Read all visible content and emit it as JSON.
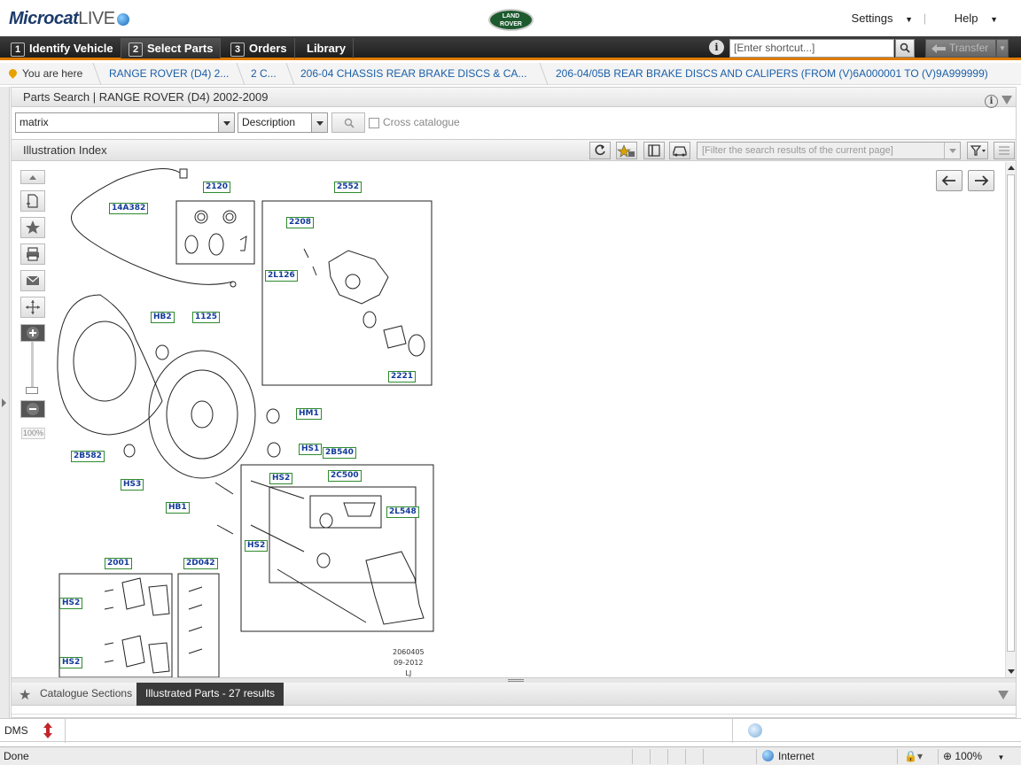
{
  "header": {
    "logo_main": "Microcat",
    "logo_live": "LIVE",
    "brand_line1": "LAND",
    "brand_line2": "ROVER",
    "settings_label": "Settings",
    "help_label": "Help"
  },
  "nav": {
    "tabs": [
      {
        "num": "1",
        "label": "Identify Vehicle"
      },
      {
        "num": "2",
        "label": "Select Parts"
      },
      {
        "num": "3",
        "label": "Orders"
      },
      {
        "num": "",
        "label": "Library"
      }
    ],
    "info_glyph": "i",
    "shortcut_placeholder": "[Enter shortcut...]",
    "transfer_label": "Transfer"
  },
  "breadcrumb": {
    "here": "You are here",
    "items": [
      "RANGE ROVER (D4) 2...",
      "2 C...",
      "206-04 CHASSIS REAR BRAKE DISCS & CA...",
      "206-04/05B REAR BRAKE DISCS AND CALIPERS (FROM (V)6A000001 TO (V)9A999999)"
    ]
  },
  "parts_search": {
    "title": "Parts Search | RANGE ROVER (D4) 2002-2009",
    "query": "matrix",
    "field": "Description",
    "cross_catalogue_label": "Cross catalogue",
    "cross_catalogue_checked": false
  },
  "illustration": {
    "title": "Illustration Index",
    "filter_placeholder": "[Filter the search results of the current page]",
    "zoom": "100%",
    "labels": [
      "14A382",
      "2120",
      "2552",
      "2208",
      "2L126",
      "2221",
      "HB2",
      "1125",
      "HM1",
      "HS1",
      "2B582",
      "HS3",
      "2B540",
      "2C500",
      "HS2",
      "HB1",
      "2L548",
      "HS2",
      "2001",
      "2D042",
      "HS2",
      "HS2"
    ],
    "stamp_lines": [
      "2060405",
      "09-2012",
      "LJ"
    ]
  },
  "bottom_tabs": {
    "sections_label": "Catalogue Sections",
    "results_label": "Illustrated Parts - 27 results"
  },
  "dms": {
    "label": "DMS"
  },
  "status": {
    "left": "Done",
    "zone": "Internet",
    "zoom": "100%"
  },
  "colors": {
    "nav_accent": "#e07b00",
    "link": "#1a5fa8",
    "part_label_border": "#2e8a2e",
    "part_label_text": "#123a9a"
  }
}
